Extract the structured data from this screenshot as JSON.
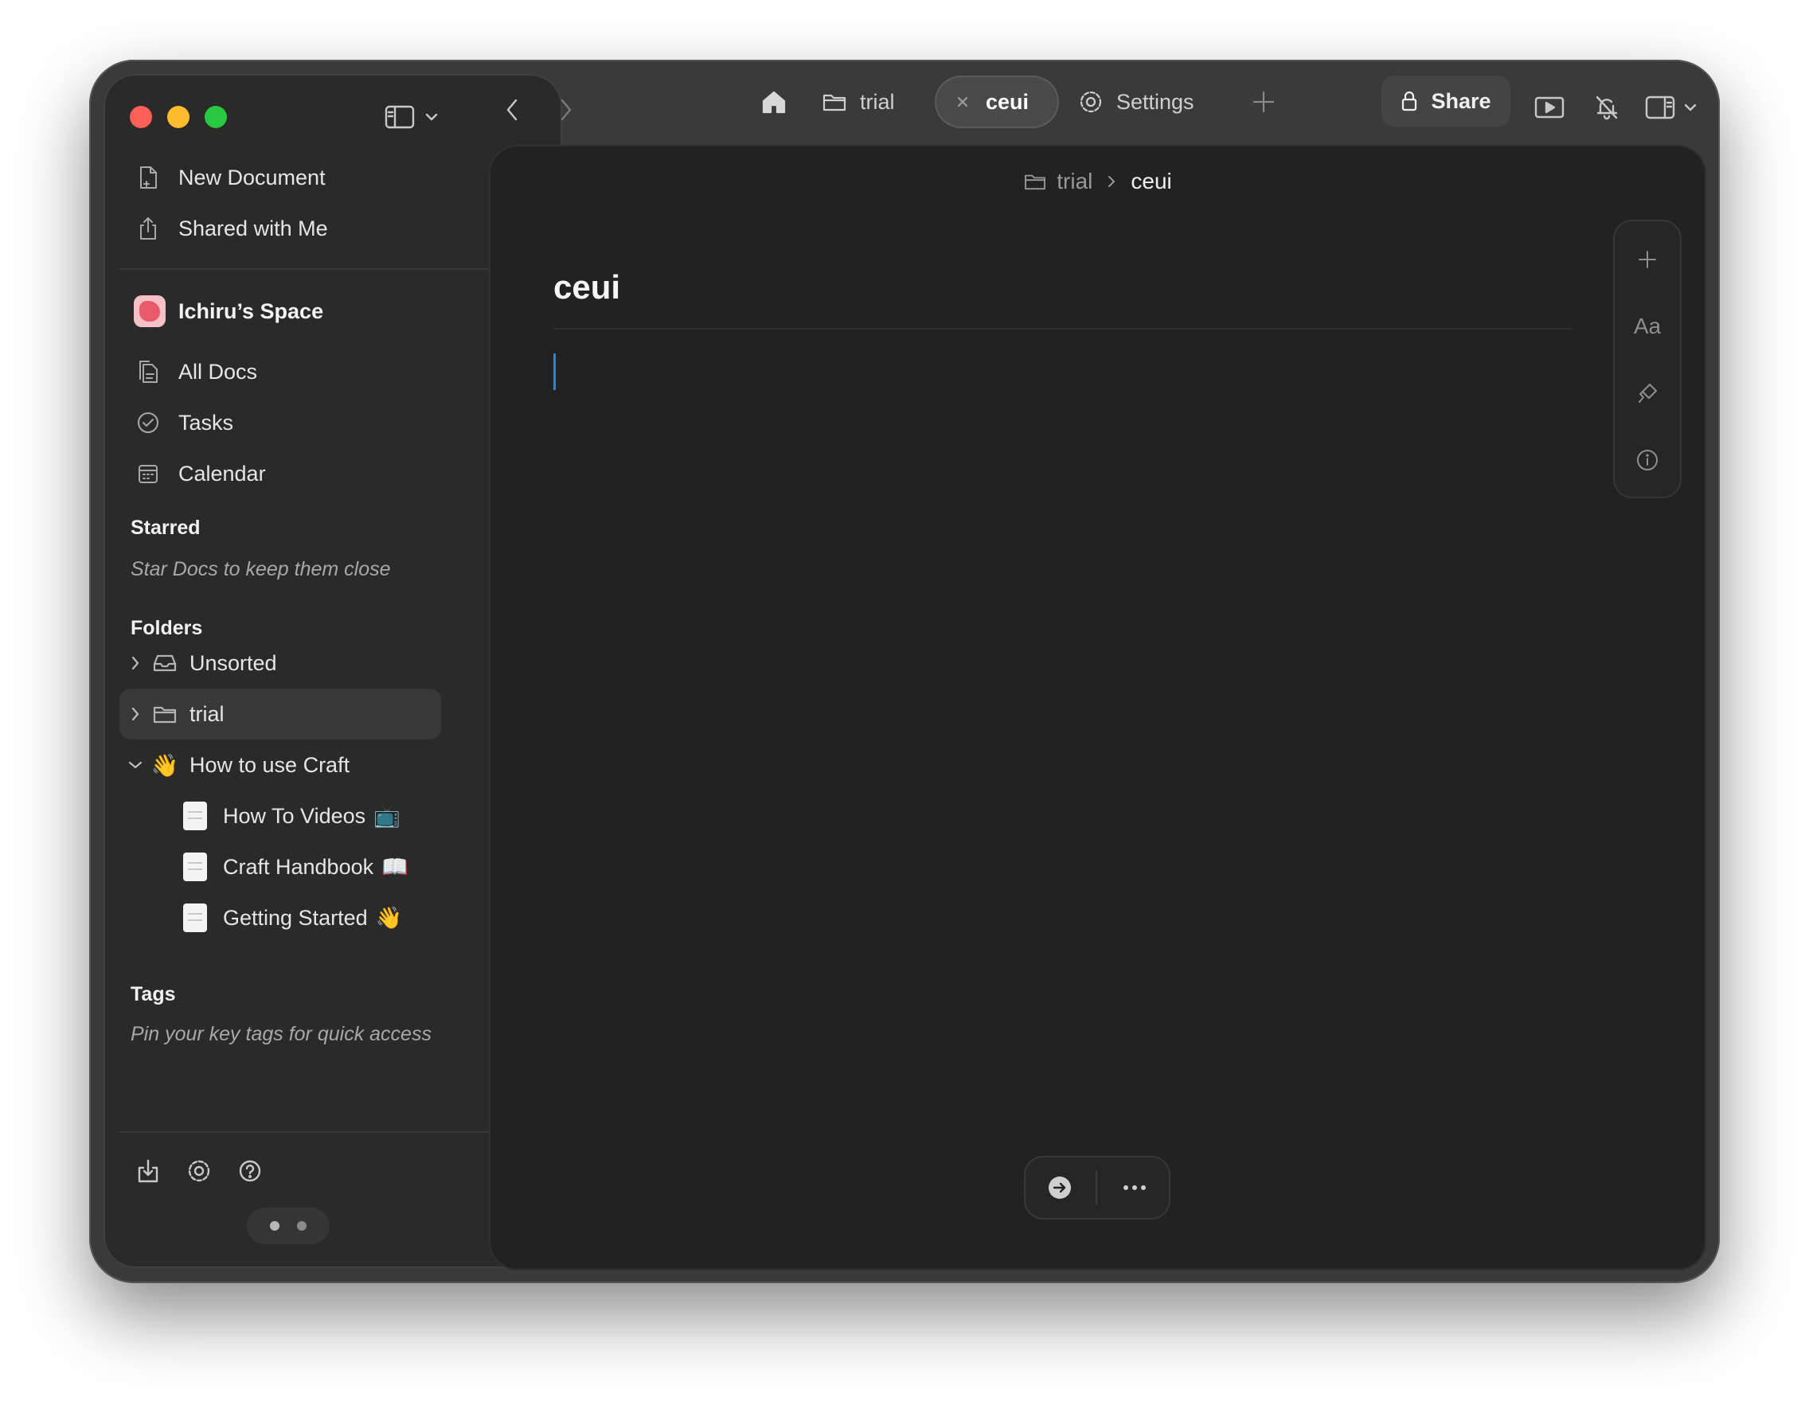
{
  "window": {
    "traffic_lights": [
      "close",
      "minimize",
      "zoom"
    ]
  },
  "sidebar": {
    "top_items": [
      {
        "label": "New Document",
        "icon": "new-document-icon"
      },
      {
        "label": "Shared with Me",
        "icon": "share-icon"
      }
    ],
    "space": {
      "name": "Ichiru’s Space",
      "avatar_color": "#e85a6a"
    },
    "nav_items": [
      {
        "label": "All Docs",
        "icon": "docs-icon"
      },
      {
        "label": "Tasks",
        "icon": "check-circle-icon"
      },
      {
        "label": "Calendar",
        "icon": "calendar-icon"
      }
    ],
    "starred": {
      "heading": "Starred",
      "hint": "Star Docs to keep them close"
    },
    "folders": {
      "heading": "Folders",
      "items": [
        {
          "label": "Unsorted",
          "icon": "inbox-icon",
          "expanded": false
        },
        {
          "label": "trial",
          "icon": "folder-icon",
          "expanded": false,
          "selected": true
        },
        {
          "label": "How to use Craft",
          "emoji": "👋",
          "expanded": true
        }
      ],
      "children": [
        {
          "label": "How To Videos",
          "emoji": "📺"
        },
        {
          "label": "Craft Handbook",
          "emoji": "📖"
        },
        {
          "label": "Getting Started",
          "emoji": "👋"
        }
      ]
    },
    "tags": {
      "heading": "Tags",
      "hint": "Pin your key tags for quick access"
    },
    "footer_icons": [
      "import-icon",
      "settings-icon",
      "help-icon"
    ]
  },
  "topbar": {
    "tabs": [
      {
        "label": "",
        "icon": "home-icon"
      },
      {
        "label": "trial",
        "icon": "folder-icon"
      },
      {
        "label": "ceui",
        "icon": "close-icon",
        "active": true
      },
      {
        "label": "Settings",
        "icon": "settings-icon"
      }
    ],
    "share_label": "Share"
  },
  "editor": {
    "breadcrumb": [
      "trial",
      "ceui"
    ],
    "title": "ceui"
  },
  "side_tools": {
    "text_style_label": "Aa"
  },
  "colors": {
    "accent_caret": "#3b82c4",
    "window_bg": "#3a3a3a",
    "editor_bg": "#222222",
    "sidebar_bg": "#2a2a2a"
  }
}
